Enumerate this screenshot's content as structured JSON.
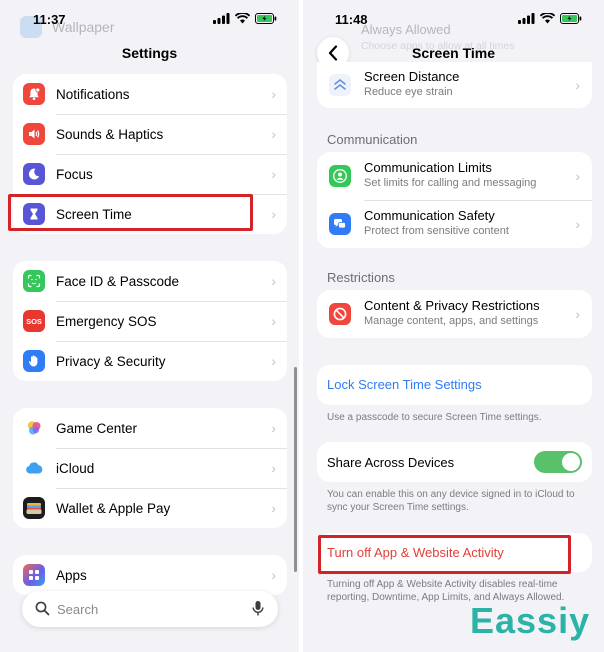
{
  "left": {
    "status_time": "11:37",
    "ghost_label": "Wallpaper",
    "title": "Settings",
    "group1": [
      {
        "label": "Notifications",
        "color": "#f0473d"
      },
      {
        "label": "Sounds & Haptics",
        "color": "#f0473d"
      },
      {
        "label": "Focus",
        "color": "#5856d6"
      },
      {
        "label": "Screen Time",
        "color": "#5856d6"
      }
    ],
    "group2": [
      {
        "label": "Face ID & Passcode",
        "color": "#34c759"
      },
      {
        "label": "Emergency SOS",
        "color": "#e8372f",
        "icon_text": "SOS"
      },
      {
        "label": "Privacy & Security",
        "color": "#2f7cf6"
      }
    ],
    "group3": [
      {
        "label": "Game Center",
        "color": "#ffffff"
      },
      {
        "label": "iCloud",
        "color": "#ffffff"
      },
      {
        "label": "Wallet & Apple Pay",
        "color": "#1c1c1e"
      }
    ],
    "group4": [
      {
        "label": "Apps",
        "color": "#6a5ee8"
      }
    ],
    "search_placeholder": "Search"
  },
  "right": {
    "status_time": "11:48",
    "ghost_title": "Always Allowed",
    "ghost_sub": "Choose apps to allow at all times",
    "title": "Screen Time",
    "screen_distance": {
      "title": "Screen Distance",
      "sub": "Reduce eye strain"
    },
    "communication_header": "Communication",
    "communication": [
      {
        "title": "Communication Limits",
        "sub": "Set limits for calling and messaging",
        "color": "#34c759"
      },
      {
        "title": "Communication Safety",
        "sub": "Protect from sensitive content",
        "color": "#2f7cf6"
      }
    ],
    "restrictions_header": "Restrictions",
    "restrictions": [
      {
        "title": "Content & Privacy Restrictions",
        "sub": "Manage content, apps, and settings",
        "color": "#f0473d"
      }
    ],
    "lock_label": "Lock Screen Time Settings",
    "lock_note": "Use a passcode to secure Screen Time settings.",
    "share_label": "Share Across Devices",
    "share_on": true,
    "share_note": "You can enable this on any device signed in to iCloud to sync your Screen Time settings.",
    "turnoff_label": "Turn off App & Website Activity",
    "turnoff_note": "Turning off App & Website Activity disables real-time reporting, Downtime, App Limits, and Always Allowed."
  },
  "watermark": "Eassiy",
  "colors": {
    "accent_blue": "#2f7cf6",
    "destructive_red": "#e0403a",
    "highlight_red": "#d32328",
    "toggle_green": "#59c169"
  }
}
